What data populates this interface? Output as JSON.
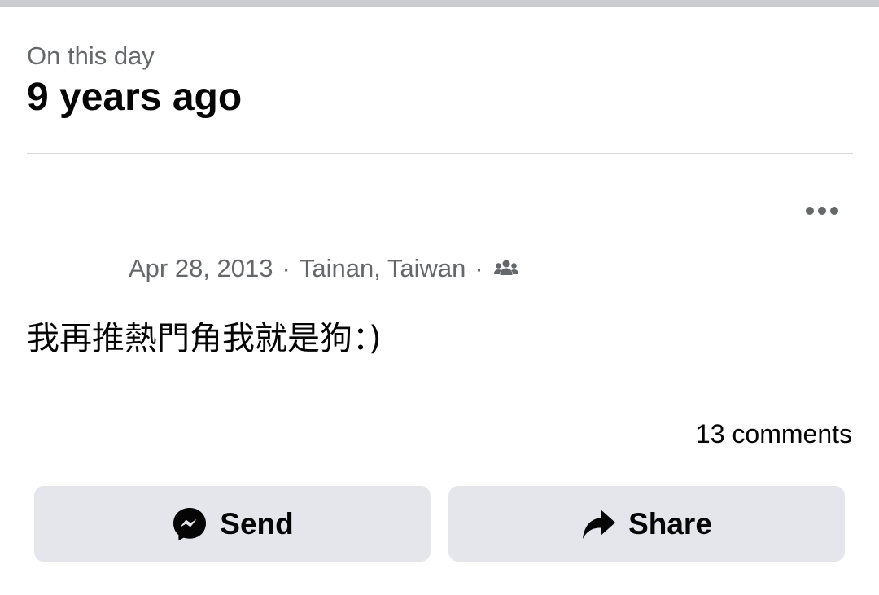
{
  "memory_header": {
    "eyebrow": "On this day",
    "title": "9 years ago"
  },
  "post": {
    "more_icon": "more-horizontal-icon",
    "date": "Apr 28, 2013",
    "separator": "·",
    "location": "Tainan, Taiwan",
    "audience_icon": "friends-icon",
    "text": "我再推熱門角我就是狗：)",
    "comments_count": "13 comments"
  },
  "actions": {
    "send_label": "Send",
    "send_icon": "messenger-icon",
    "share_label": "Share",
    "share_icon": "share-arrow-icon"
  },
  "colors": {
    "secondary_text": "#65676b",
    "primary_text": "#050505",
    "button_bg": "#e4e6eb",
    "divider": "#d4d6da"
  }
}
